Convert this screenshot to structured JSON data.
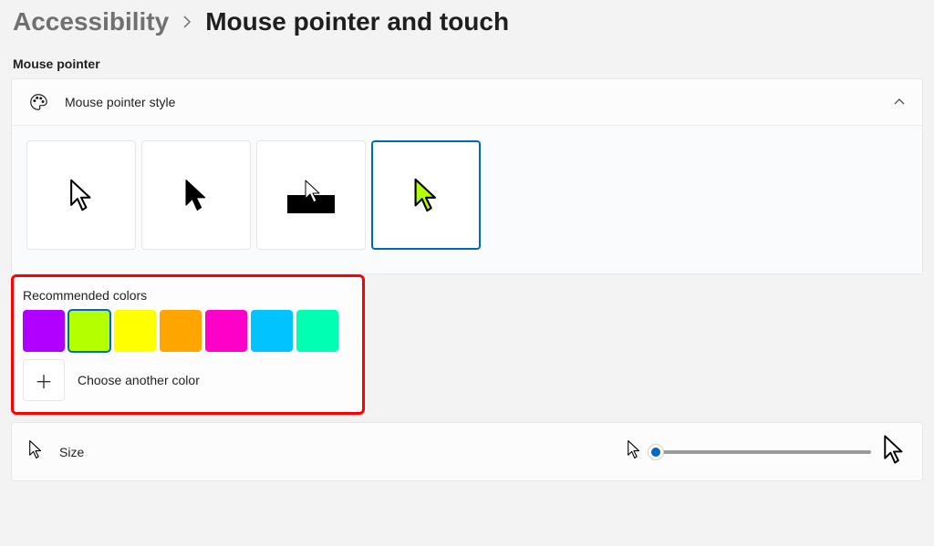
{
  "breadcrumb": {
    "parent": "Accessibility",
    "current": "Mouse pointer and touch"
  },
  "section_header": "Mouse pointer",
  "style_card": {
    "title": "Mouse pointer style",
    "selected_index": 3,
    "custom_color": "#b4ff00"
  },
  "recommended": {
    "title": "Recommended colors",
    "selected_index": 1,
    "colors": [
      "#b000ff",
      "#b4ff00",
      "#ffff00",
      "#ffa500",
      "#ff00c8",
      "#00c3ff",
      "#00ffb0"
    ],
    "choose_label": "Choose another color"
  },
  "size": {
    "label": "Size",
    "value": 0,
    "min": 0,
    "max": 100
  }
}
